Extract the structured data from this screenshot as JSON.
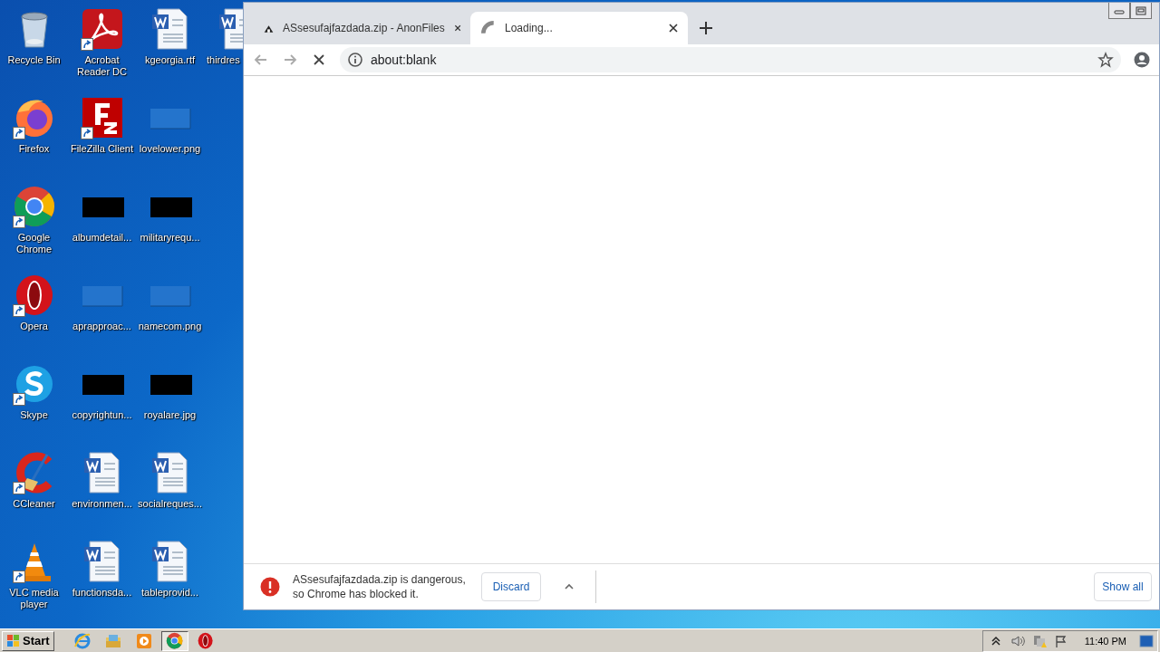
{
  "desktop": {
    "rows": [
      [
        {
          "label": "Recycle Bin",
          "kind": "recycle",
          "shortcut": false
        },
        {
          "label": "Acrobat Reader DC",
          "kind": "acrobat",
          "shortcut": true
        },
        {
          "label": "kgeorgia.rtf",
          "kind": "word",
          "shortcut": false
        },
        {
          "label": "thirdres",
          "kind": "word",
          "shortcut": false
        }
      ],
      [
        {
          "label": "Firefox",
          "kind": "firefox",
          "shortcut": true
        },
        {
          "label": "FileZilla Client",
          "kind": "filezilla",
          "shortcut": true
        },
        {
          "label": "lovelower.png",
          "kind": "blank-image",
          "shortcut": false
        }
      ],
      [
        {
          "label": "Google Chrome",
          "kind": "chrome",
          "shortcut": true
        },
        {
          "label": "albumdetail...",
          "kind": "dark-image",
          "shortcut": false
        },
        {
          "label": "militaryrequ...",
          "kind": "dark-image",
          "shortcut": false
        }
      ],
      [
        {
          "label": "Opera",
          "kind": "opera",
          "shortcut": true
        },
        {
          "label": "aprapproac...",
          "kind": "blank-image",
          "shortcut": false
        },
        {
          "label": "namecom.png",
          "kind": "blank-image",
          "shortcut": false
        }
      ],
      [
        {
          "label": "Skype",
          "kind": "skype",
          "shortcut": true
        },
        {
          "label": "copyrightun...",
          "kind": "dark-image",
          "shortcut": false
        },
        {
          "label": "royalare.jpg",
          "kind": "dark-image",
          "shortcut": false
        }
      ],
      [
        {
          "label": "CCleaner",
          "kind": "ccleaner",
          "shortcut": true
        },
        {
          "label": "environmen...",
          "kind": "word",
          "shortcut": false
        },
        {
          "label": "socialreques...",
          "kind": "word",
          "shortcut": false
        }
      ],
      [
        {
          "label": "VLC media player",
          "kind": "vlc",
          "shortcut": true
        },
        {
          "label": "functionsda...",
          "kind": "word",
          "shortcut": false
        },
        {
          "label": "tableprovid...",
          "kind": "word",
          "shortcut": false
        }
      ]
    ]
  },
  "browser": {
    "tabs": [
      {
        "title": "ASsesufajfazdada.zip - AnonFiles",
        "selected": false,
        "loading": false
      },
      {
        "title": "Loading...",
        "selected": true,
        "loading": true
      }
    ],
    "address": "about:blank",
    "download": {
      "lines": [
        "ASsesufajfazdada.zip is dangerous,",
        "so Chrome has blocked it."
      ],
      "button": "Discard",
      "show_all": "Show all"
    }
  },
  "taskbar": {
    "start": "Start",
    "apps": [
      {
        "kind": "ie",
        "selected": false
      },
      {
        "kind": "explorer",
        "selected": false
      },
      {
        "kind": "media",
        "selected": false
      },
      {
        "kind": "chrome",
        "selected": true
      },
      {
        "kind": "opera",
        "selected": false
      }
    ],
    "clock": "11:40 PM"
  }
}
